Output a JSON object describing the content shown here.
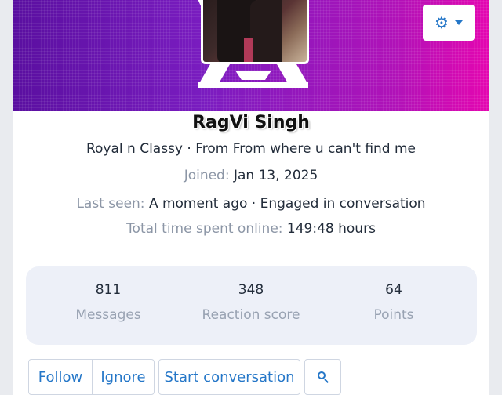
{
  "profile": {
    "name": "RagVi Singh",
    "tagline": "Royal n Classy · From From where u can't find me",
    "joined_label": "Joined:",
    "joined_value": "Jan 13, 2025",
    "last_seen_label": "Last seen:",
    "last_seen_value": "A moment ago · Engaged in conversation",
    "time_online_label": "Total time spent online:",
    "time_online_value": "149:48 hours"
  },
  "stats": [
    {
      "value": "811",
      "label": "Messages"
    },
    {
      "value": "348",
      "label": "Reaction score"
    },
    {
      "value": "64",
      "label": "Points"
    }
  ],
  "actions": {
    "follow": "Follow",
    "ignore": "Ignore",
    "start_conversation": "Start conversation",
    "search_icon": "search-icon"
  },
  "header": {
    "settings_icon": "gear-icon",
    "dropdown_icon": "caret-down-icon"
  },
  "colors": {
    "accent": "#2577c8",
    "banner_start": "#5a0fa0",
    "banner_end": "#e406b0",
    "muted_text": "#8c96a6",
    "body_text": "#222c3a",
    "stats_bg": "#edf0f8"
  }
}
